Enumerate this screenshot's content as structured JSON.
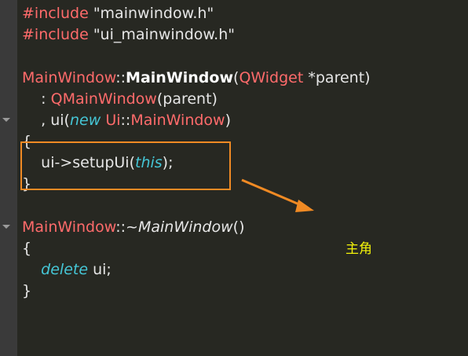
{
  "editor": {
    "lines": [
      {
        "a": "#include ",
        "b": "\"mainwindow.h\""
      },
      {
        "a": "#include ",
        "b": "\"ui_mainwindow.h\""
      },
      {
        "cls": "MainWindow",
        "sep": "::",
        "fn": "MainWindow",
        "open": "(",
        "type": "QWidget",
        "rest": " *parent)"
      },
      {
        "prefix": "    : ",
        "cls": "QMainWindow",
        "rest": "(parent)"
      },
      {
        "prefix": "    , ui(",
        "kw": "new",
        "space": " ",
        "cls": "Ui",
        "sep": "::",
        "cls2": "MainWindow",
        "rest": ")"
      },
      {
        "text": "{"
      },
      {
        "prefix": "    ui->setupUi(",
        "kw": "this",
        "rest": ");"
      },
      {
        "text": "}"
      },
      {
        "cls": "MainWindow",
        "sep": "::~",
        "fn": "MainWindow",
        "rest": "()"
      },
      {
        "text": "{"
      },
      {
        "prefix": "    ",
        "kw": "delete",
        "rest": " ui;"
      },
      {
        "text": "}"
      }
    ]
  },
  "annotation": {
    "label": "主角",
    "color": "#f2f20a",
    "arrow_color": "#f08a24"
  },
  "colors": {
    "background": "#272822",
    "gutter": "#3a3a3a",
    "class_name": "#ff6b6b",
    "keyword": "#45c6d6",
    "highlight_border": "#f08a24"
  }
}
